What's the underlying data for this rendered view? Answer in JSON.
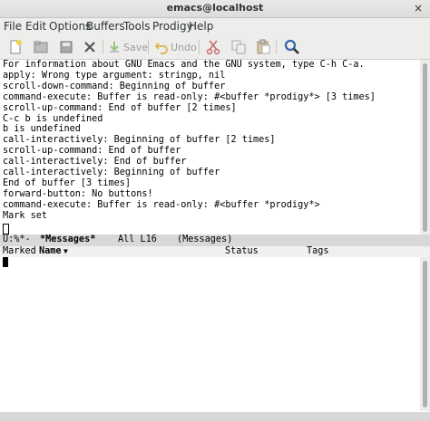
{
  "window": {
    "title": "emacs@localhost",
    "close_glyph": "×"
  },
  "menu": [
    "File",
    "Edit",
    "Options",
    "Buffers",
    "Tools",
    "Prodigy",
    "Help"
  ],
  "toolbar": {
    "save_label": "Save",
    "undo_label": "Undo",
    "icons": [
      "new-file-icon",
      "open-folder-icon",
      "save-disk-icon",
      "close-buffer-icon",
      "save-icon",
      "undo-icon",
      "cut-icon",
      "copy-icon",
      "paste-icon",
      "search-icon"
    ]
  },
  "messages": {
    "lines": [
      "For information about GNU Emacs and the GNU system, type C-h C-a.",
      "apply: Wrong type argument: stringp, nil",
      "scroll-down-command: Beginning of buffer",
      "command-execute: Buffer is read-only: #<buffer *prodigy*> [3 times]",
      "scroll-up-command: End of buffer [2 times]",
      "C-c b is undefined",
      "b is undefined",
      "call-interactively: Beginning of buffer [2 times]",
      "scroll-up-command: End of buffer",
      "call-interactively: End of buffer",
      "call-interactively: Beginning of buffer",
      "End of buffer [3 times]",
      "forward-button: No buttons!",
      "command-execute: Buffer is read-only: #<buffer *prodigy*>",
      "Mark set"
    ]
  },
  "modeline": {
    "status": "U:%*-",
    "buffer_name": "*Messages*",
    "position": "All L16",
    "mode": "(Messages)"
  },
  "prodigy_header": {
    "marked": "Marked",
    "name": "Name",
    "sort_indicator": "▼",
    "status": "Status",
    "tags": "Tags"
  }
}
